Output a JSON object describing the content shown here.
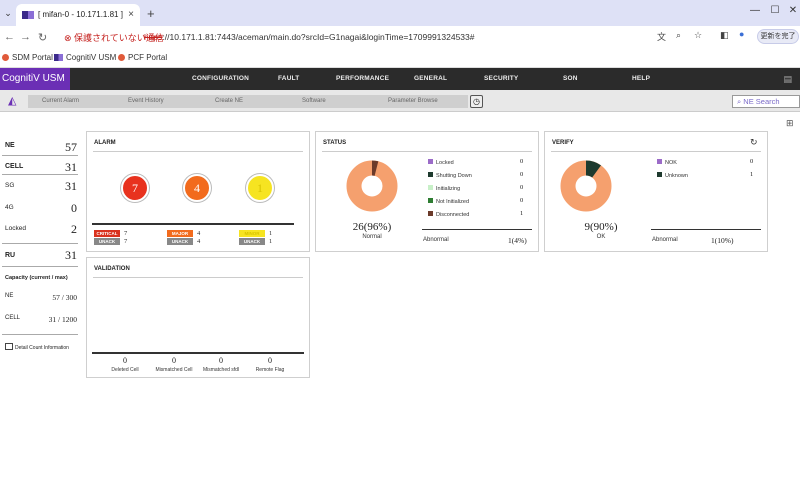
{
  "browser": {
    "tab_title": "[ mifan-0 - 10.171.1.81 ]",
    "security_warning": "保護されていない通信",
    "url_scheme": "https",
    "url_rest": "://10.171.1.81:7443/aceman/main.do?srcId=G1nagai&loginTime=1709991324533#",
    "update_label": "更新を完了",
    "bookmarks": [
      "SDM Portal",
      "CognitiV USM",
      "PCF Portal"
    ]
  },
  "app": {
    "logo": "CognitiV USM",
    "menu": [
      "CONFIGURATION",
      "FAULT",
      "PERFORMANCE",
      "GENERAL",
      "SECURITY",
      "SON",
      "HELP"
    ],
    "subnav": [
      "Current Alarm",
      "Event History",
      "Create NE",
      "Software",
      "Parameter Browse"
    ],
    "search_placeholder": "NE Search"
  },
  "summary": {
    "rows": [
      {
        "label": "NE",
        "value": "57"
      },
      {
        "label": "CELL",
        "value": "31"
      },
      {
        "label": "SG",
        "value": "31"
      },
      {
        "label": "4G",
        "value": "0"
      },
      {
        "label": "Locked",
        "value": "2"
      },
      {
        "label": "RU",
        "value": "31"
      }
    ],
    "capacity_title": "Capacity (current / max)",
    "capacity": [
      {
        "label": "NE",
        "value": "57 / 300"
      },
      {
        "label": "CELL",
        "value": "31 / 1200"
      }
    ],
    "detail_link": "Detail Count Information"
  },
  "alarm": {
    "title": "ALARM",
    "circles": [
      {
        "value": "7",
        "color": "#e8321e"
      },
      {
        "value": "4",
        "color": "#f26b1d"
      },
      {
        "value": "1",
        "color": "#f6e421"
      }
    ],
    "severities": [
      {
        "label": "CRITICAL",
        "color": "#d9321e",
        "count": "7",
        "unack": "7"
      },
      {
        "label": "MAJOR",
        "color": "#f26b1d",
        "count": "4",
        "unack": "4"
      },
      {
        "label": "MINOR",
        "color": "#f6e421",
        "count": "1",
        "unack": "1"
      }
    ],
    "unack_label": "UNACK"
  },
  "status": {
    "title": "STATUS",
    "legend": [
      {
        "label": "Locked",
        "value": "0",
        "color": "#9b6bc8"
      },
      {
        "label": "Shutting Down",
        "value": "0",
        "color": "#1e3a2e"
      },
      {
        "label": "Initializing",
        "value": "0",
        "color": "#c8f0c8"
      },
      {
        "label": "Not Initialized",
        "value": "0",
        "color": "#2e7d32"
      },
      {
        "label": "Disconnected",
        "value": "1",
        "color": "#6b3a2a"
      }
    ],
    "normal_value": "26(96%)",
    "normal_label": "Normal",
    "normal_fraction": 0.96,
    "abnormal_label": "Abnormal",
    "abnormal_value": "1(4%)"
  },
  "verify": {
    "title": "VERIFY",
    "legend": [
      {
        "label": "NOK",
        "value": "0",
        "color": "#9b6bc8"
      },
      {
        "label": "Unknown",
        "value": "1",
        "color": "#1e3a2e"
      }
    ],
    "ok_value": "9(90%)",
    "ok_label": "OK",
    "ok_fraction": 0.9,
    "abnormal_label": "Abnormal",
    "abnormal_value": "1(10%)"
  },
  "validation": {
    "title": "VALIDATION",
    "items": [
      {
        "label": "Deleted Cell",
        "value": "0"
      },
      {
        "label": "Mismatched Cell",
        "value": "0"
      },
      {
        "label": "Mismatched sfdl",
        "value": "0"
      },
      {
        "label": "Remote Flag",
        "value": "0"
      }
    ]
  },
  "colors": {
    "donut_main": "#f5a06e",
    "accent": "#6b2fb5"
  }
}
